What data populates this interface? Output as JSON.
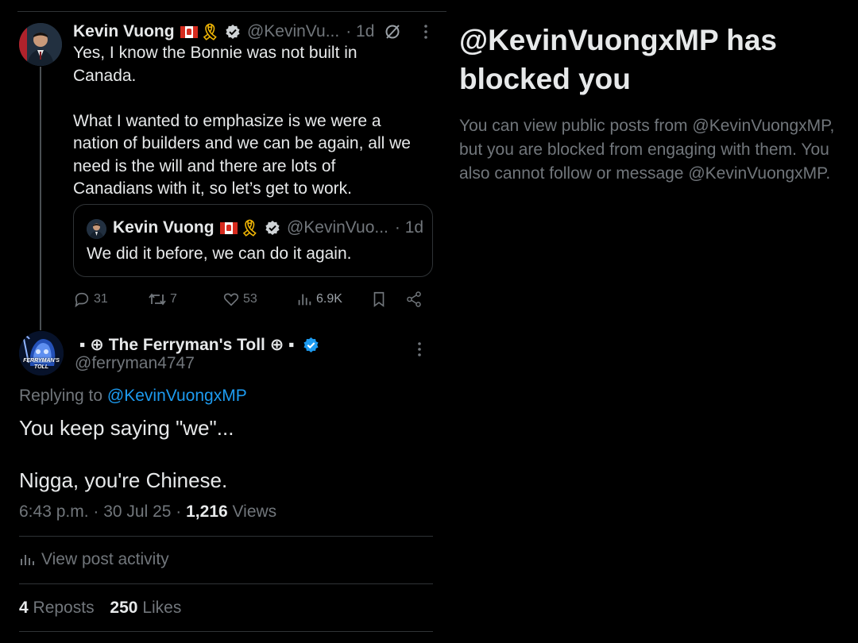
{
  "parent_tweet": {
    "author_name": "Kevin Vuong",
    "author_emoji": "🎗",
    "handle": "@KevinVu...",
    "time": "· 1d",
    "body_lines": [
      "Yes, I know the Bonnie was not built in",
      "Canada.",
      "",
      "What I wanted to emphasize is we were a",
      "nation of builders and we can be again, all we",
      "need is the will and there are lots of",
      "Canadians with it, so let’s get to work."
    ],
    "quoted": {
      "author_name": "Kevin Vuong",
      "author_emoji": "🎗",
      "handle": "@KevinVuo...",
      "time": "· 1d",
      "text": "We did it before, we can do it again."
    },
    "actions": {
      "replies": "31",
      "reposts": "7",
      "likes": "53",
      "views": "6.9K"
    }
  },
  "reply_tweet": {
    "author_name": "▪ ⊕ The Ferryman's Toll ⊕ ▪",
    "handle": "@ferryman4747",
    "replying_prefix": "Replying to",
    "replying_to": "@KevinVuongxMP",
    "text_line1": "You keep saying \"we\"...",
    "text_line2": "Nigga, you're Chinese.",
    "timestamp": "6:43 p.m. · 30 Jul 25 ·",
    "views_count": "1,216",
    "views_label": "Views",
    "view_activity_label": "View post activity",
    "reposts_count": "4",
    "reposts_label": "Reposts",
    "likes_count": "250",
    "likes_label": "Likes",
    "avatar_text": "FERRYMAN'S TOLL"
  },
  "blocked_panel": {
    "title_line1": "@KevinVuongxMP has",
    "title_line2": "blocked you",
    "description": "You can view public posts from @KevinVuongxMP, but you are blocked from engaging with them. You also cannot follow or message @KevinVuongxMP."
  },
  "colors": {
    "background": "#000000",
    "text": "#e7e9ea",
    "muted": "#71767b",
    "link": "#1d9bf0",
    "verified": "#1d9bf0",
    "border": "#2f3336"
  }
}
